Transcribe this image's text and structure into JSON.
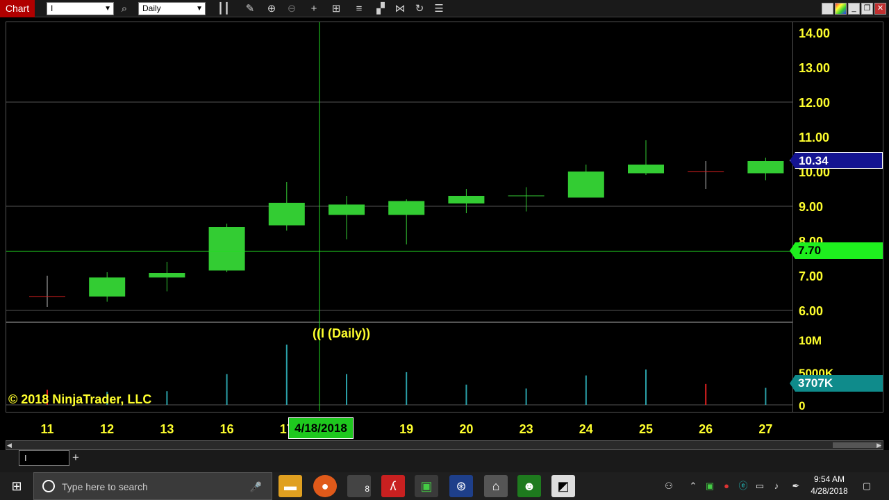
{
  "toolbar": {
    "chart_label": "Chart",
    "instrument": "I",
    "interval": "Daily",
    "icons": [
      "search-icon",
      "bar-type-icon",
      "pencil-draw-icon",
      "zoom-in-icon",
      "zoom-out-icon",
      "crosshair-icon",
      "data-box-icon",
      "strategies-icon",
      "indicators-icon",
      "chart-trader-icon",
      "refresh-icon",
      "properties-icon"
    ]
  },
  "window_buttons": [
    "tile-icon",
    "color-icon",
    "minimize-icon",
    "restore-icon",
    "close-icon"
  ],
  "overlay": {
    "panel_label": "((I (Daily))",
    "copyright": "© 2018 NinjaTrader, LLC",
    "last_price": "10.34",
    "crosshair_price": "7.70",
    "volume_value": "3707K",
    "crosshair_date": "4/18/2018"
  },
  "colors": {
    "up_candle": "#33cc33",
    "down_candle": "#e02020",
    "volume_bar": "#2aa0a8",
    "axis_text": "#ffff2e",
    "crosshair": "#22dd22",
    "grid": "#555555"
  },
  "chart_data": {
    "type": "candlestick",
    "x": [
      "11",
      "12",
      "13",
      "16",
      "17",
      "18",
      "19",
      "20",
      "23",
      "24",
      "25",
      "26",
      "27"
    ],
    "ohlc": [
      {
        "open": 6.4,
        "high": 7.0,
        "low": 6.1,
        "close": 6.4
      },
      {
        "open": 6.4,
        "high": 7.1,
        "low": 6.25,
        "close": 6.95
      },
      {
        "open": 6.95,
        "high": 7.4,
        "low": 6.55,
        "close": 7.08
      },
      {
        "open": 7.15,
        "high": 8.5,
        "low": 7.1,
        "close": 8.4
      },
      {
        "open": 8.45,
        "high": 9.7,
        "low": 8.3,
        "close": 9.1
      },
      {
        "open": 8.75,
        "high": 9.3,
        "low": 8.05,
        "close": 9.05
      },
      {
        "open": 8.75,
        "high": 9.2,
        "low": 7.9,
        "close": 9.15
      },
      {
        "open": 9.08,
        "high": 9.5,
        "low": 8.8,
        "close": 9.3
      },
      {
        "open": 9.3,
        "high": 9.55,
        "low": 8.85,
        "close": 9.3
      },
      {
        "open": 9.25,
        "high": 10.2,
        "low": 9.25,
        "close": 10.0
      },
      {
        "open": 9.95,
        "high": 10.9,
        "low": 9.9,
        "close": 10.2
      },
      {
        "open": 10.0,
        "high": 10.3,
        "low": 9.5,
        "close": 10.0
      },
      {
        "open": 9.95,
        "high": 10.4,
        "low": 9.75,
        "close": 10.3
      }
    ],
    "direction": [
      "down",
      "up",
      "up",
      "up",
      "up",
      "up",
      "up",
      "up",
      "up",
      "up",
      "up",
      "down",
      "up"
    ],
    "volume": [
      2300000,
      2000000,
      2100000,
      4700000,
      9200000,
      4700000,
      5000000,
      3100000,
      2500000,
      4500000,
      5400000,
      3200000,
      2600000
    ],
    "ylim": [
      5.7,
      14.3
    ],
    "y_ticks": [
      "14.00",
      "13.00",
      "12.00",
      "11.00",
      "10.00",
      "9.00",
      "8.00",
      "7.00",
      "6.00"
    ],
    "volume_ticks": [
      "10M",
      "5000K",
      "0"
    ],
    "volume_ylim": [
      0,
      12000000
    ],
    "grid_y": [
      12.0,
      9.0,
      6.0
    ]
  },
  "bottom_tab": {
    "label": "I",
    "add": "+"
  },
  "taskbar": {
    "search_placeholder": "Type here to search",
    "apps": [
      "file-explorer-icon",
      "firefox-icon",
      "ninjatrader-icon",
      "acrobat-icon",
      "greenshot-icon",
      "satellite-app-icon",
      "bank-app-icon",
      "android-app-icon",
      "sticky-notes-icon"
    ],
    "app_badge": "8",
    "time": "9:54 AM",
    "date": "4/28/2018"
  }
}
